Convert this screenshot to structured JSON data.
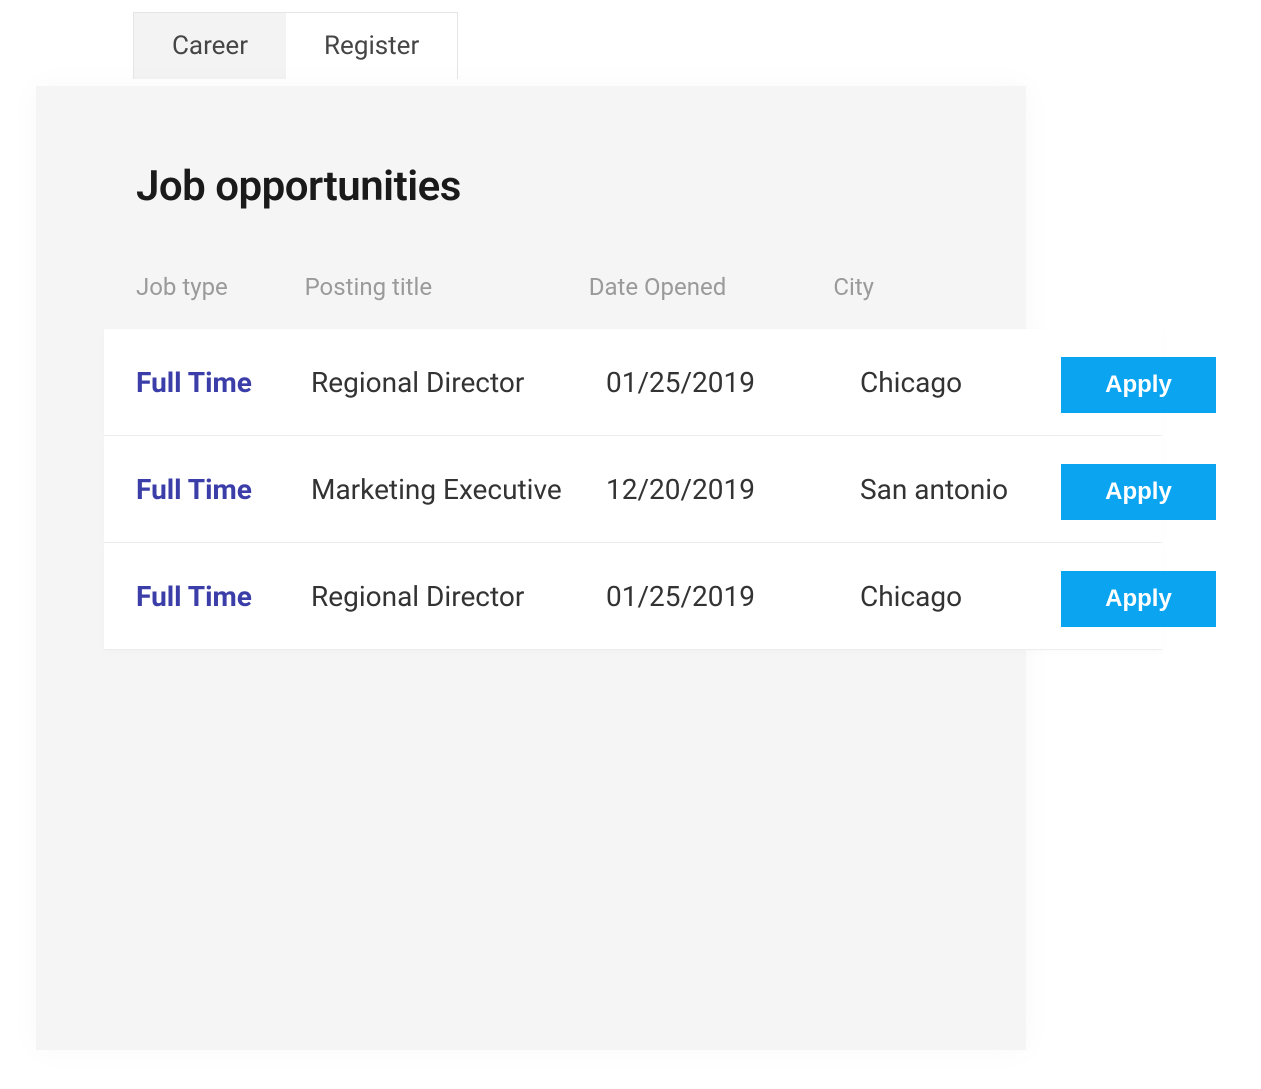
{
  "tabs": {
    "career": "Career",
    "register": "Register"
  },
  "page": {
    "title": "Job opportunities"
  },
  "table": {
    "headers": {
      "jobtype": "Job type",
      "title": "Posting title",
      "date": "Date Opened",
      "city": "City"
    },
    "rows": [
      {
        "jobtype": "Full Time",
        "title": "Regional Director",
        "date": "01/25/2019",
        "city": "Chicago",
        "apply": "Apply"
      },
      {
        "jobtype": "Full Time",
        "title": "Marketing Executive",
        "date": "12/20/2019",
        "city": "San antonio",
        "apply": "Apply"
      },
      {
        "jobtype": "Full Time",
        "title": "Regional Director",
        "date": "01/25/2019",
        "city": "Chicago",
        "apply": "Apply"
      }
    ]
  }
}
